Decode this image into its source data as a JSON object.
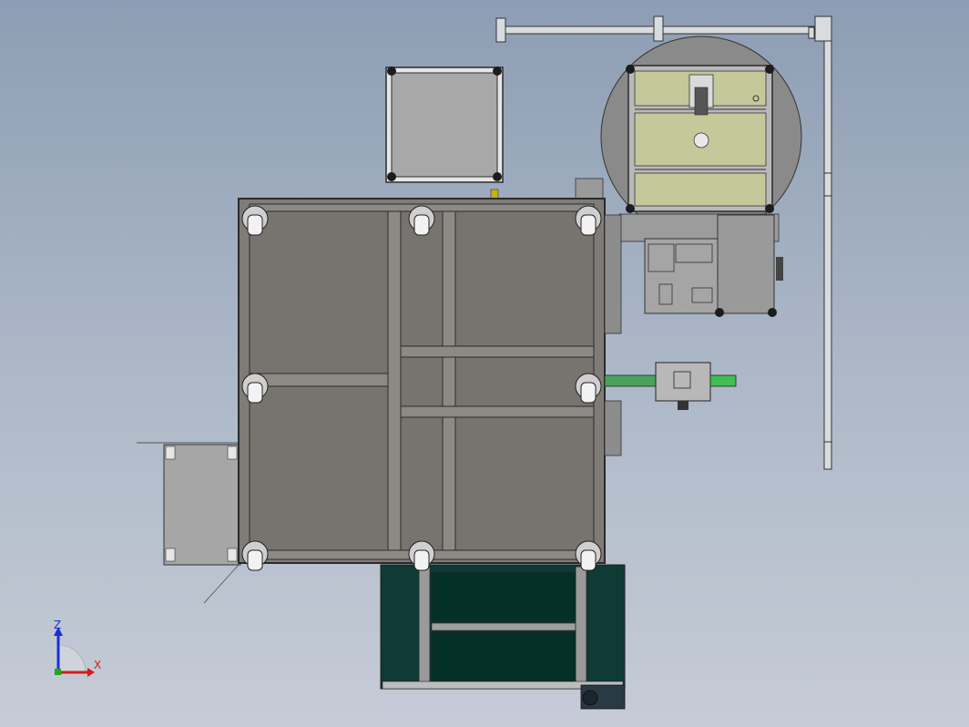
{
  "triad": {
    "z_label": "Z",
    "x_label": "X",
    "z_color": "#1a2fd6",
    "x_color": "#d61a1a",
    "y_color": "#1aa81a"
  },
  "colors": {
    "frame_fill": "#7f7c78",
    "frame_stroke": "#2b2b2b",
    "table_fill": "#c4c89a",
    "conveyor_fill": "#0f3a35",
    "panel_fill": "#a7a7a7",
    "motor_fill": "#2a3a45",
    "accent_green": "#3fbf4f"
  },
  "components": [
    "main-frame",
    "frame-casters",
    "top-cover-panel",
    "rotary-table",
    "control-box",
    "side-electrical-box",
    "belt-conveyor",
    "conveyor-drive-motor",
    "cylinder-actuator",
    "overhead-rail"
  ]
}
